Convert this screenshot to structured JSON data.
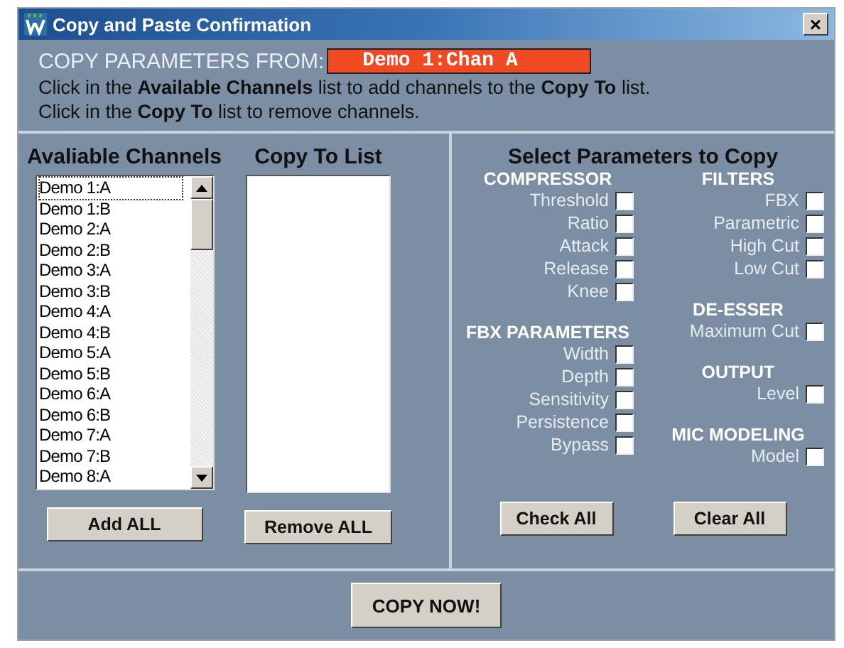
{
  "window": {
    "title": "Copy and Paste Confirmation",
    "close": "×"
  },
  "header": {
    "label": "COPY PARAMETERS FROM:",
    "source": "Demo 1:Chan A",
    "lines": [
      "Click in the **Available Channels** list to add channels to the **Copy To** list.",
      "Click in the **Copy To** list to remove channels."
    ]
  },
  "available": {
    "title": "Avaliable Channels",
    "items": [
      {
        "label": "Demo 1:A",
        "selected": true
      },
      {
        "label": "Demo 1:B",
        "selected": false
      },
      {
        "label": "Demo 2:A",
        "selected": false
      },
      {
        "label": "Demo 2:B",
        "selected": false
      },
      {
        "label": "Demo 3:A",
        "selected": false
      },
      {
        "label": "Demo 3:B",
        "selected": false
      },
      {
        "label": "Demo 4:A",
        "selected": false
      },
      {
        "label": "Demo 4:B",
        "selected": false
      },
      {
        "label": "Demo 5:A",
        "selected": false
      },
      {
        "label": "Demo 5:B",
        "selected": false
      },
      {
        "label": "Demo 6:A",
        "selected": false
      },
      {
        "label": "Demo 6:B",
        "selected": false
      },
      {
        "label": "Demo 7:A",
        "selected": false
      },
      {
        "label": "Demo 7:B",
        "selected": false
      },
      {
        "label": "Demo 8:A",
        "selected": false
      }
    ],
    "button": "Add ALL"
  },
  "copy_to": {
    "title": "Copy To  List",
    "button": "Remove ALL"
  },
  "parameters": {
    "title": "Select Parameters to Copy",
    "columns": [
      [
        {
          "title": "COMPRESSOR",
          "items": [
            {
              "label": "Threshold",
              "checked": false
            },
            {
              "label": "Ratio",
              "checked": false
            },
            {
              "label": "Attack",
              "checked": false
            },
            {
              "label": "Release",
              "checked": false
            },
            {
              "label": "Knee",
              "checked": false
            }
          ]
        },
        {
          "title": "FBX PARAMETERS",
          "items": [
            {
              "label": "Width",
              "checked": false
            },
            {
              "label": "Depth",
              "checked": false
            },
            {
              "label": "Sensitivity",
              "checked": false
            },
            {
              "label": "Persistence",
              "checked": false
            },
            {
              "label": "Bypass",
              "checked": false
            }
          ]
        }
      ],
      [
        {
          "title": "FILTERS",
          "items": [
            {
              "label": "FBX",
              "checked": false
            },
            {
              "label": "Parametric",
              "checked": false
            },
            {
              "label": "High Cut",
              "checked": false
            },
            {
              "label": "Low Cut",
              "checked": false
            }
          ]
        },
        {
          "title": "DE-ESSER",
          "items": [
            {
              "label": "Maximum Cut",
              "checked": false
            }
          ]
        },
        {
          "title": "OUTPUT",
          "items": [
            {
              "label": "Level",
              "checked": false
            }
          ]
        },
        {
          "title": "MIC MODELING",
          "items": [
            {
              "label": "Model",
              "checked": false
            }
          ]
        }
      ]
    ],
    "buttons": [
      "Check All",
      "Clear All"
    ]
  },
  "copy_now": "COPY NOW!"
}
